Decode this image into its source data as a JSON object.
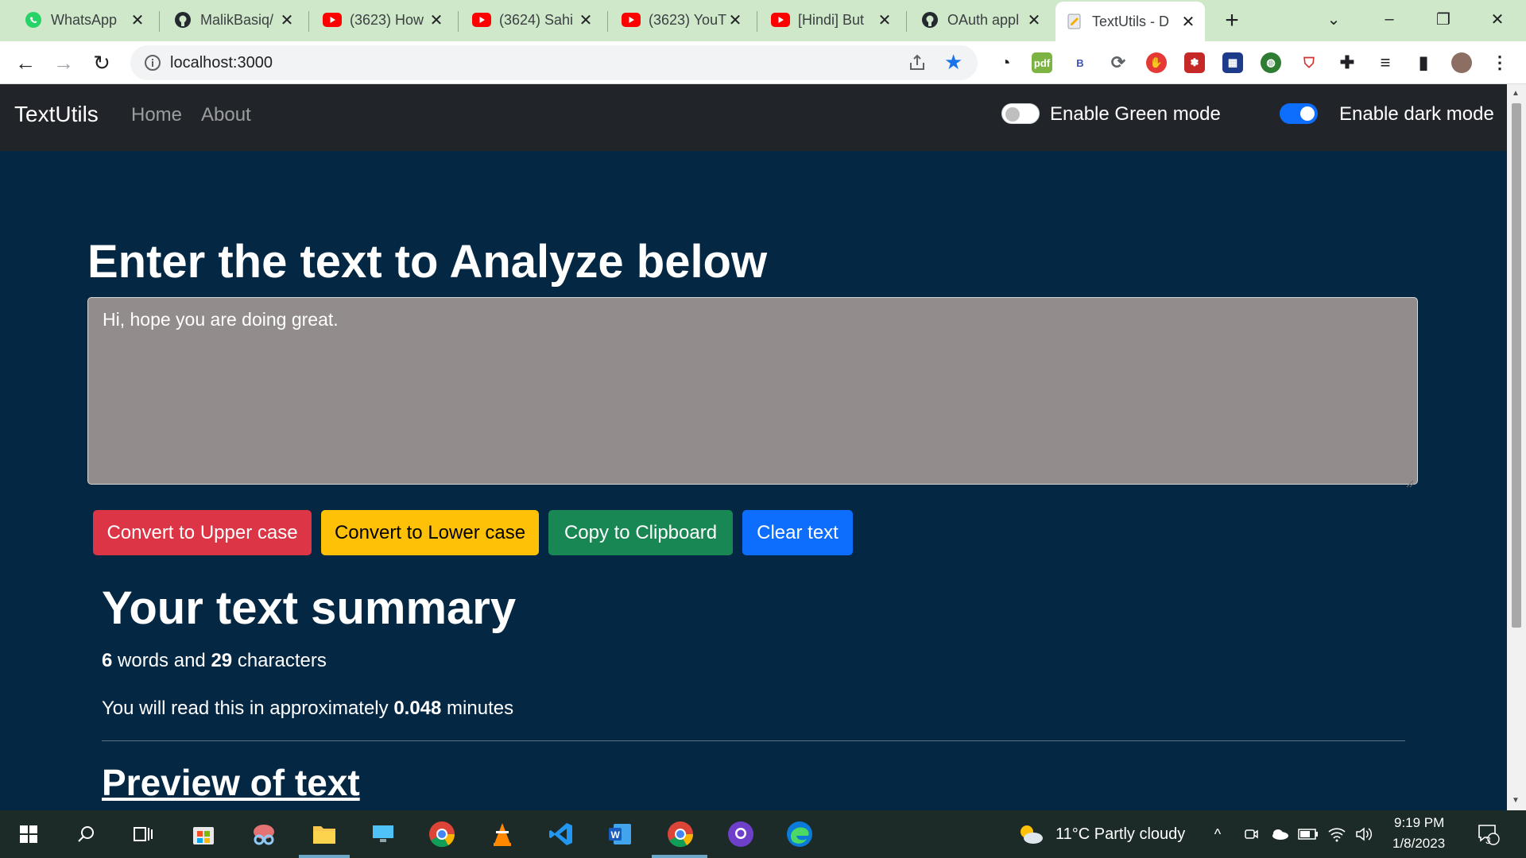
{
  "browser": {
    "tabs": [
      {
        "title": "WhatsApp",
        "icon": "whatsapp-icon"
      },
      {
        "title": "MalikBasiq/",
        "icon": "github-icon"
      },
      {
        "title": "(3623) How",
        "icon": "youtube-icon"
      },
      {
        "title": "(3624) Sahi",
        "icon": "youtube-icon"
      },
      {
        "title": "(3623) YouT",
        "icon": "youtube-icon"
      },
      {
        "title": "[Hindi] But",
        "icon": "youtube-icon"
      },
      {
        "title": "OAuth appl",
        "icon": "github-icon"
      },
      {
        "title": "TextUtils - D",
        "icon": "page-icon",
        "active": true
      }
    ],
    "url": "localhost:3000"
  },
  "app": {
    "brand": "TextUtils",
    "nav": {
      "home": "Home",
      "about": "About"
    },
    "green_mode_label": "Enable Green mode",
    "green_mode_on": false,
    "dark_mode_label": "Enable dark mode",
    "dark_mode_on": true,
    "heading": "Enter the text to Analyze below",
    "textarea_value": "Hi, hope you are doing great.",
    "buttons": {
      "upper": "Convert to Upper case",
      "lower": "Convert to Lower case",
      "copy": "Copy to Clipboard",
      "clear": "Clear text"
    },
    "summary": {
      "heading": "Your text summary",
      "words": "6",
      "words_label": "words and",
      "chars": "29",
      "chars_label": "characters",
      "read_prefix": "You will read this in approximately",
      "read_minutes": "0.048",
      "read_suffix": "minutes"
    },
    "preview_heading": "Preview of text"
  },
  "taskbar": {
    "weather": "11°C  Partly cloudy",
    "time": "9:19 PM",
    "date": "1/8/2023",
    "notifications": "3"
  },
  "colors": {
    "page_bg": "#042743",
    "navbar_bg": "#212529",
    "textarea_bg": "#938c8c",
    "danger": "#dc3545",
    "warning": "#ffc107",
    "success": "#198754",
    "primary": "#0d6efd"
  }
}
